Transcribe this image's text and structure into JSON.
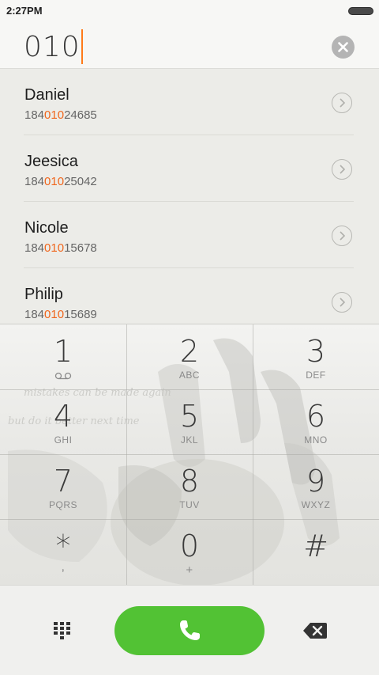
{
  "status_bar": {
    "time": "2:27PM"
  },
  "dialer": {
    "input_value": "010"
  },
  "contacts": [
    {
      "name": "Daniel",
      "number_prefix": "184",
      "number_match": "010",
      "number_suffix": "24685"
    },
    {
      "name": "Jeesica",
      "number_prefix": "184",
      "number_match": "010",
      "number_suffix": "25042"
    },
    {
      "name": "Nicole",
      "number_prefix": "184",
      "number_match": "010",
      "number_suffix": "15678"
    },
    {
      "name": "Philip",
      "number_prefix": "184",
      "number_match": "010",
      "number_suffix": "15689"
    }
  ],
  "keypad": {
    "keys": [
      {
        "digit": "1",
        "letters": ""
      },
      {
        "digit": "2",
        "letters": "ABC"
      },
      {
        "digit": "3",
        "letters": "DEF"
      },
      {
        "digit": "4",
        "letters": "GHI"
      },
      {
        "digit": "5",
        "letters": "JKL"
      },
      {
        "digit": "6",
        "letters": "MNO"
      },
      {
        "digit": "7",
        "letters": "PQRS"
      },
      {
        "digit": "8",
        "letters": "TUV"
      },
      {
        "digit": "9",
        "letters": "WXYZ"
      },
      {
        "digit": "*",
        "letters": ","
      },
      {
        "digit": "0",
        "letters": "+"
      },
      {
        "digit": "#",
        "letters": ""
      }
    ]
  },
  "icons": {
    "battery": "battery-icon",
    "clear": "clear-icon",
    "detail": "chevron-right-icon",
    "voicemail": "voicemail-icon",
    "keypad_toggle": "dialpad-icon",
    "call": "phone-icon",
    "backspace": "backspace-icon"
  },
  "colors": {
    "match_highlight": "#f0661c",
    "call_button": "#52c234",
    "caret": "#ff7a1a"
  }
}
